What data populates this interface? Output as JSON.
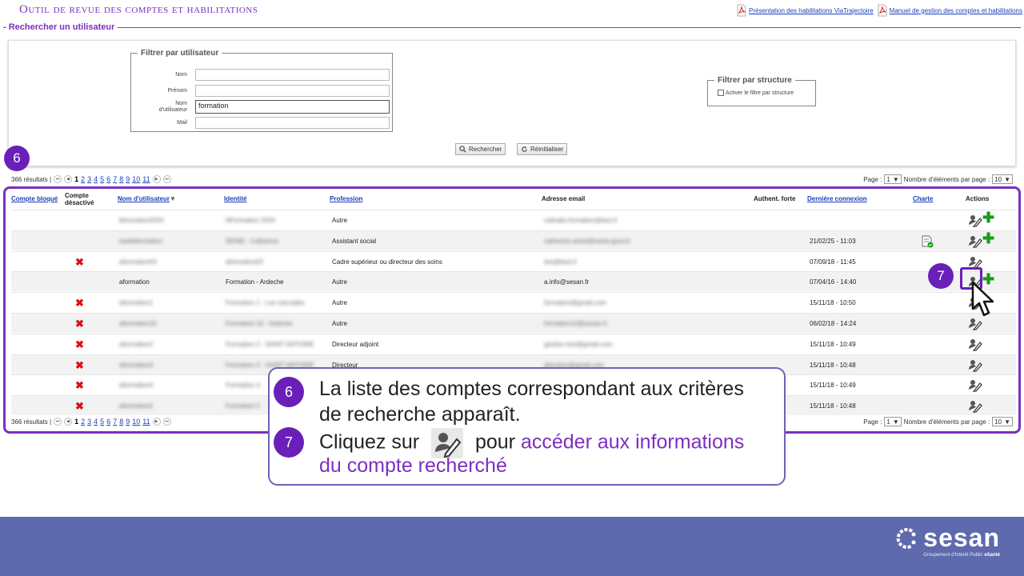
{
  "header": {
    "app_title": "Outil de revue des comptes et habilitations",
    "doc_link_1": "Présentation des habilitations ViaTrajectoire",
    "doc_link_2": "Manuel de gestion des comptes et habilitations"
  },
  "search_section": {
    "title": "- Rechercher un utilisateur",
    "user_filter": {
      "legend": "Filtrer par utilisateur",
      "nom_label": "Nom",
      "nom_value": "",
      "prenom_label": "Prénom",
      "prenom_value": "",
      "username_label_1": "Nom",
      "username_label_2": "d'utilisateur",
      "username_value": "formation",
      "mail_label": "Mail",
      "mail_value": ""
    },
    "struct_filter": {
      "legend": "Filtrer par structure",
      "checkbox_label": "Activer le filtre par structure",
      "checked": false
    },
    "search_button": "Rechercher",
    "reset_button": "Réinitialiser"
  },
  "pager": {
    "results": "366 résultats |",
    "pages": [
      "1",
      "2",
      "3",
      "4",
      "5",
      "6",
      "7",
      "8",
      "9",
      "10",
      "11"
    ],
    "current_page": "1",
    "page_label": "Page :",
    "page_value": "1",
    "per_page_label": "Nombre d'éléments par page :",
    "per_page_value": "10"
  },
  "table": {
    "headers": {
      "compte_bloque": "Compte bloqué",
      "compte_desactive_1": "Compte",
      "compte_desactive_2": "désactivé",
      "nom_utilisateur": "Nom d'utilisateur",
      "identite": "Identité",
      "profession": "Profession",
      "adresse_email": "Adresse email",
      "authent_forte": "Authent. forte",
      "derniere_connexion": "Dernière connexion",
      "charte": "Charte",
      "actions": "Actions"
    },
    "rows": [
      {
        "desactive": false,
        "username": "bformation2024",
        "identite": "NFormation 2024",
        "profession": "Autre",
        "email": "nathalie.formation@test.fr",
        "connexion": "",
        "charte": false,
        "plus": true,
        "blur": true
      },
      {
        "desactive": false,
        "username": "aselleformation",
        "identite": "SEINE - Catherine",
        "profession": "Assistant social",
        "email": "catherine.seine@sante.gouv.fr",
        "connexion": "21/02/25 - 11:03",
        "charte": true,
        "plus": true,
        "blur": true
      },
      {
        "desactive": true,
        "username": "aformation03",
        "identite": "aformation03",
        "profession": "Cadre supérieur ou directeur des soins",
        "email": "test@test.fr",
        "connexion": "07/09/18 - 11:45",
        "charte": false,
        "plus": false,
        "blur": true
      },
      {
        "desactive": false,
        "username": "aformation",
        "identite": "Formation - Ardeche",
        "profession": "Autre",
        "email": "a.info@sesan.fr",
        "connexion": "07/04/16 - 14:40",
        "charte": false,
        "plus": true,
        "blur": false
      },
      {
        "desactive": true,
        "username": "aformation1",
        "identite": "Formation 1 - Les cascades",
        "profession": "Autre",
        "email": "formation@gmail.com",
        "connexion": "15/11/18 - 10:50",
        "charte": false,
        "plus": false,
        "blur": true
      },
      {
        "desactive": true,
        "username": "aformation10",
        "identite": "Formation 10 - Ardeche",
        "profession": "Autre",
        "email": "formation10@sesan.fr",
        "connexion": "06/02/18 - 14:24",
        "charte": false,
        "plus": false,
        "blur": true
      },
      {
        "desactive": true,
        "username": "aformation2",
        "identite": "Formation 2 - SAINT ANTOINE",
        "profession": "Directeur adjoint",
        "email": "gestion.test@gmail.com",
        "connexion": "15/11/18 - 10:49",
        "charte": false,
        "plus": false,
        "blur": true
      },
      {
        "desactive": true,
        "username": "aformation3",
        "identite": "Formation 3 - SAINT ANTOINE",
        "profession": "Directeur",
        "email": "direction@gmail.com",
        "connexion": "15/11/18 - 10:48",
        "charte": false,
        "plus": false,
        "blur": true
      },
      {
        "desactive": true,
        "username": "aformation4",
        "identite": "Formation 4",
        "profession": "",
        "email": "",
        "connexion": "15/11/18 - 10:49",
        "charte": false,
        "plus": false,
        "blur": true
      },
      {
        "desactive": true,
        "username": "aformation5",
        "identite": "Formation 5",
        "profession": "",
        "email": "",
        "connexion": "15/11/18 - 10:48",
        "charte": false,
        "plus": false,
        "blur": true
      }
    ]
  },
  "annotations": {
    "step6": "6",
    "step7": "7",
    "callout_line1": "La liste des comptes correspondant aux critères",
    "callout_line2": "de recherche apparaît.",
    "callout_line3_a": "Cliquez sur",
    "callout_line3_b": "pour",
    "callout_line3_c": "accéder aux informations",
    "callout_line4": "du compte recherché"
  },
  "footer": {
    "logo_text": "sesan",
    "logo_sub_a": "Groupement d'Intérêt Public",
    "logo_sub_b": "eSanté"
  },
  "colors": {
    "accent_purple": "#7b2fbf",
    "link_blue": "#1a3fb8",
    "footer_bg": "#5f69ae",
    "disabled_red": "#d11111",
    "add_green": "#1a9b1a"
  }
}
